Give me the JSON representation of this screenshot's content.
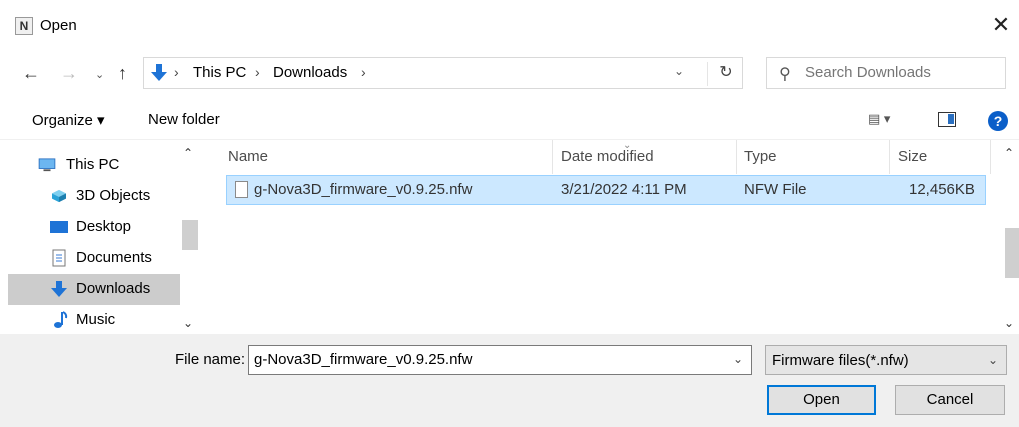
{
  "window": {
    "title": "Open",
    "app_icon_letter": "N",
    "close_symbol": "✕"
  },
  "nav": {
    "back_symbol": "←",
    "forward_symbol": "→",
    "recent_symbol": "⌄",
    "up_symbol": "↑",
    "breadcrumbs": [
      "This PC",
      "Downloads"
    ],
    "separator": "›",
    "dropdown_symbol": "⌄",
    "refresh_symbol": "↻"
  },
  "search": {
    "placeholder": "Search Downloads",
    "icon": "⚲"
  },
  "toolbar": {
    "organize_label": "Organize ▾",
    "new_folder_label": "New folder",
    "view_label": "▤ ▾",
    "help_label": "?"
  },
  "sidebar": {
    "items": [
      {
        "label": "This PC",
        "icon": "monitor-icon"
      },
      {
        "label": "3D Objects",
        "icon": "cube-icon"
      },
      {
        "label": "Desktop",
        "icon": "desktop-icon"
      },
      {
        "label": "Documents",
        "icon": "document-icon"
      },
      {
        "label": "Downloads",
        "icon": "download-icon",
        "selected": true
      },
      {
        "label": "Music",
        "icon": "music-icon"
      }
    ],
    "scroll_up": "⌃",
    "scroll_down": "⌄"
  },
  "file_list": {
    "columns": [
      "Name",
      "Date modified",
      "Type",
      "Size"
    ],
    "sort_indicator": "⌄",
    "rows": [
      {
        "name": "g-Nova3D_firmware_v0.9.25.nfw",
        "date": "3/21/2022 4:11 PM",
        "type": "NFW File",
        "size": "12,456KB"
      }
    ]
  },
  "footer": {
    "file_name_label": "File name:",
    "file_name_value": "g-Nova3D_firmware_v0.9.25.nfw",
    "file_type_label": "Firmware files(*.nfw)",
    "dropdown_symbol": "⌄",
    "open_label": "Open",
    "cancel_label": "Cancel"
  },
  "colors": {
    "selection": "#cce8ff",
    "selection_border": "#99d1ff",
    "accent": "#0078d7",
    "help": "#0b5fc9"
  }
}
